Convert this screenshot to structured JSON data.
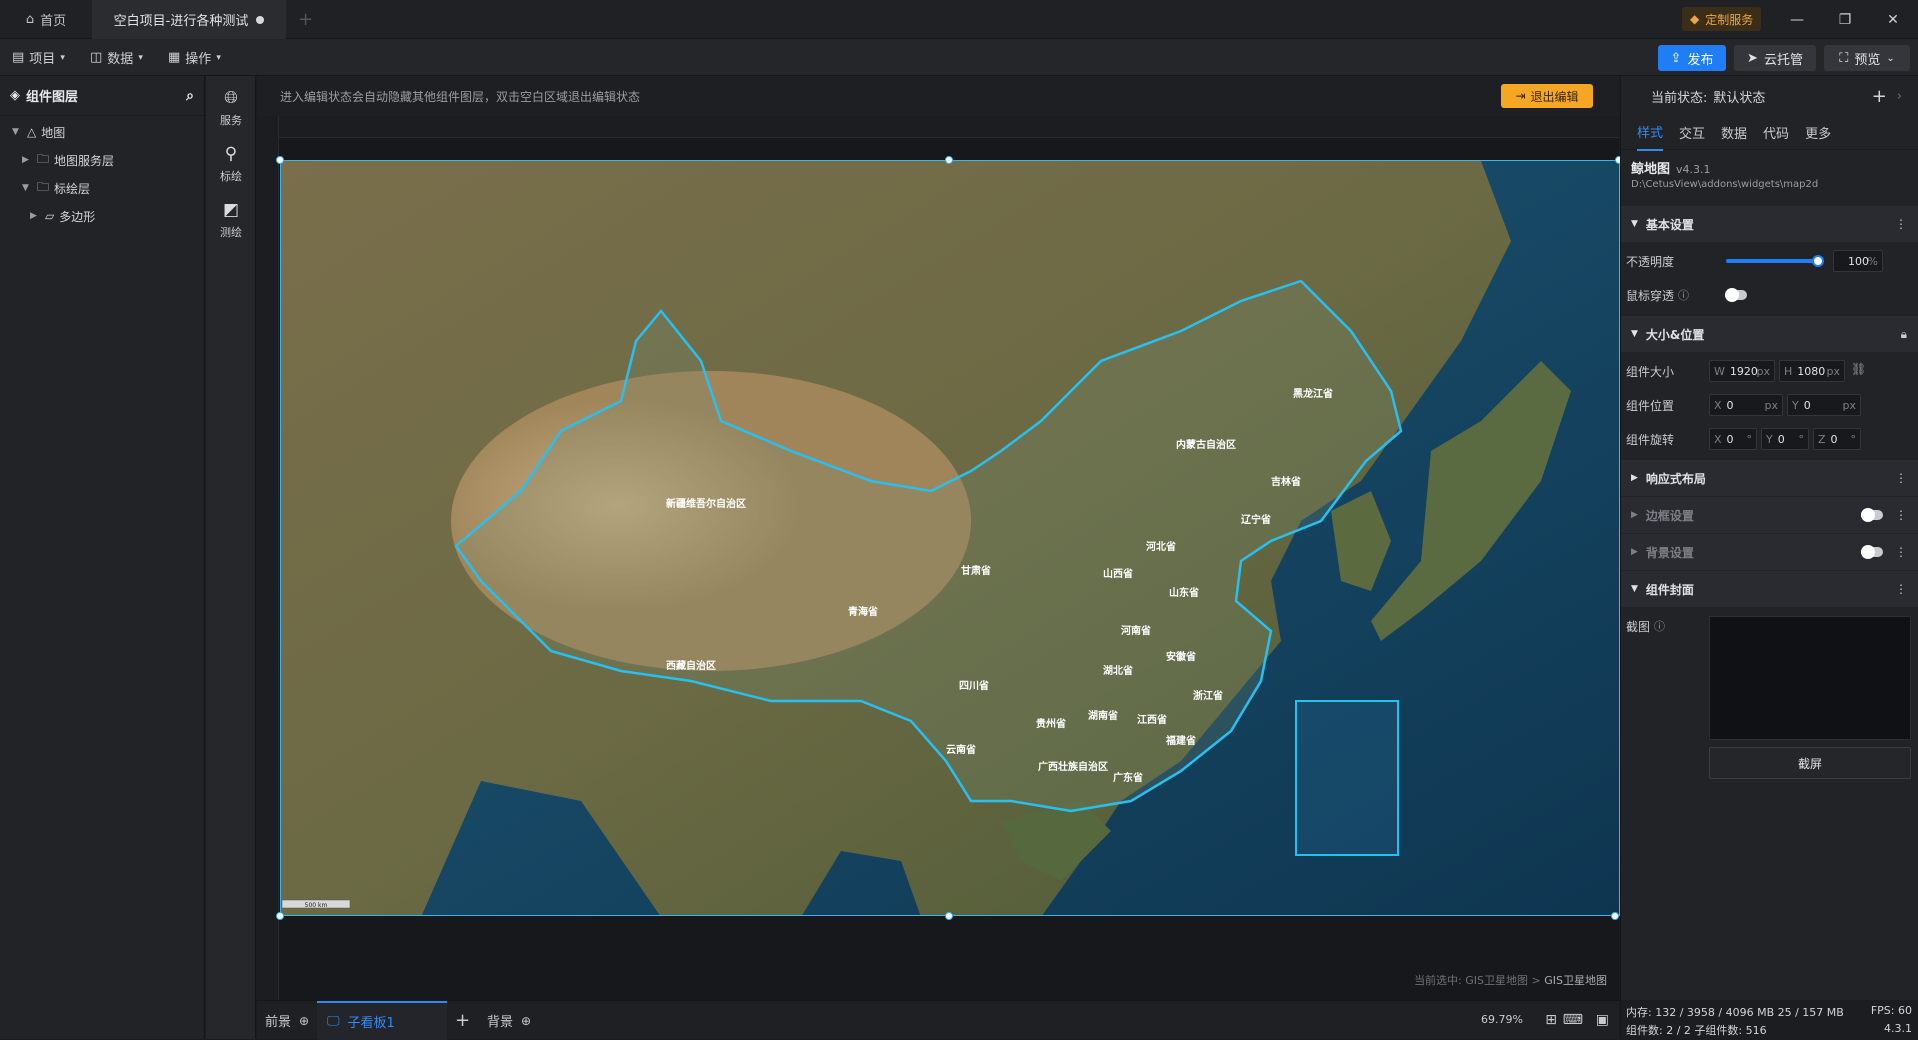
{
  "titlebar": {
    "home_tab": "首页",
    "project_tab": "空白项目-进行各种测试",
    "custom_service": "定制服务"
  },
  "menubar": {
    "project": "项目",
    "data": "数据",
    "operate": "操作",
    "publish": "发布",
    "cloud_host": "云托管",
    "preview": "预览"
  },
  "layers": {
    "title": "组件图层",
    "items": [
      {
        "label": "地图"
      },
      {
        "label": "地图服务层"
      },
      {
        "label": "标绘层"
      },
      {
        "label": "多边形"
      }
    ]
  },
  "tools": {
    "service": "服务",
    "plot": "标绘",
    "measure": "测绘"
  },
  "canvas": {
    "edit_hint": "进入编辑状态会自动隐藏其他组件图层，双击空白区域退出编辑状态",
    "exit_edit": "退出编辑",
    "breadcrumb_prefix": "当前选中: GIS卫星地图 >",
    "breadcrumb_current": "GIS卫星地图",
    "scale_label": "500 km"
  },
  "map": {
    "labels": {
      "heilongjiang": "黑龙江省",
      "neimenggu": "内蒙古自治区",
      "jilin": "吉林省",
      "liaoning": "辽宁省",
      "xinjiang": "新疆维吾尔自治区",
      "hebei": "河北省",
      "shanxi": "山西省",
      "shandong": "山东省",
      "gansu": "甘肃省",
      "qinghai": "青海省",
      "henan": "河南省",
      "anhui": "安徽省",
      "hubei": "湖北省",
      "xizang": "西藏自治区",
      "sichuan": "四川省",
      "zhejiang": "浙江省",
      "guizhou": "贵州省",
      "hunan": "湖南省",
      "jiangxi": "江西省",
      "fujian": "福建省",
      "yunnan": "云南省",
      "guangxi": "广西壮族自治区",
      "guangdong": "广东省"
    }
  },
  "bottombar": {
    "foreground": "前景",
    "subboard": "子看板1",
    "background": "背景",
    "zoom": "69.79%"
  },
  "props": {
    "state_label": "当前状态:",
    "state_value": "默认状态",
    "tabs": [
      "样式",
      "交互",
      "数据",
      "代码",
      "更多"
    ],
    "component_name": "鲸地图",
    "component_version": "v4.3.1",
    "component_path": "D:\\CetusView\\addons\\widgets\\map2d",
    "basic_settings": "基本设置",
    "opacity_label": "不透明度",
    "opacity_value": "100",
    "opacity_unit": "%",
    "opacity_level": 1.0,
    "mouse_through": "鼠标穿透",
    "size_position": "大小&位置",
    "size_label": "组件大小",
    "w_label": "W",
    "w_value": "1920",
    "h_label": "H",
    "h_value": "1080",
    "px": "px",
    "position_label": "组件位置",
    "x_label": "X",
    "x_value": "0",
    "y_label": "Y",
    "y_value": "0",
    "rotation_label": "组件旋转",
    "rx_value": "0",
    "ry_value": "0",
    "z_label": "Z",
    "rz_value": "0",
    "deg": "°",
    "responsive": "响应式布局",
    "border_settings": "边框设置",
    "bg_settings": "背景设置",
    "cover": "组件封面",
    "screenshot_label": "截图",
    "screenshot_button": "截屏"
  },
  "status": {
    "memory": "内存: 132 / 3958 / 4096 MB  25 / 157 MB",
    "fps": "FPS:  60",
    "components": "组件数: 2 / 2   子组件数: 516",
    "version": "4.3.1"
  }
}
